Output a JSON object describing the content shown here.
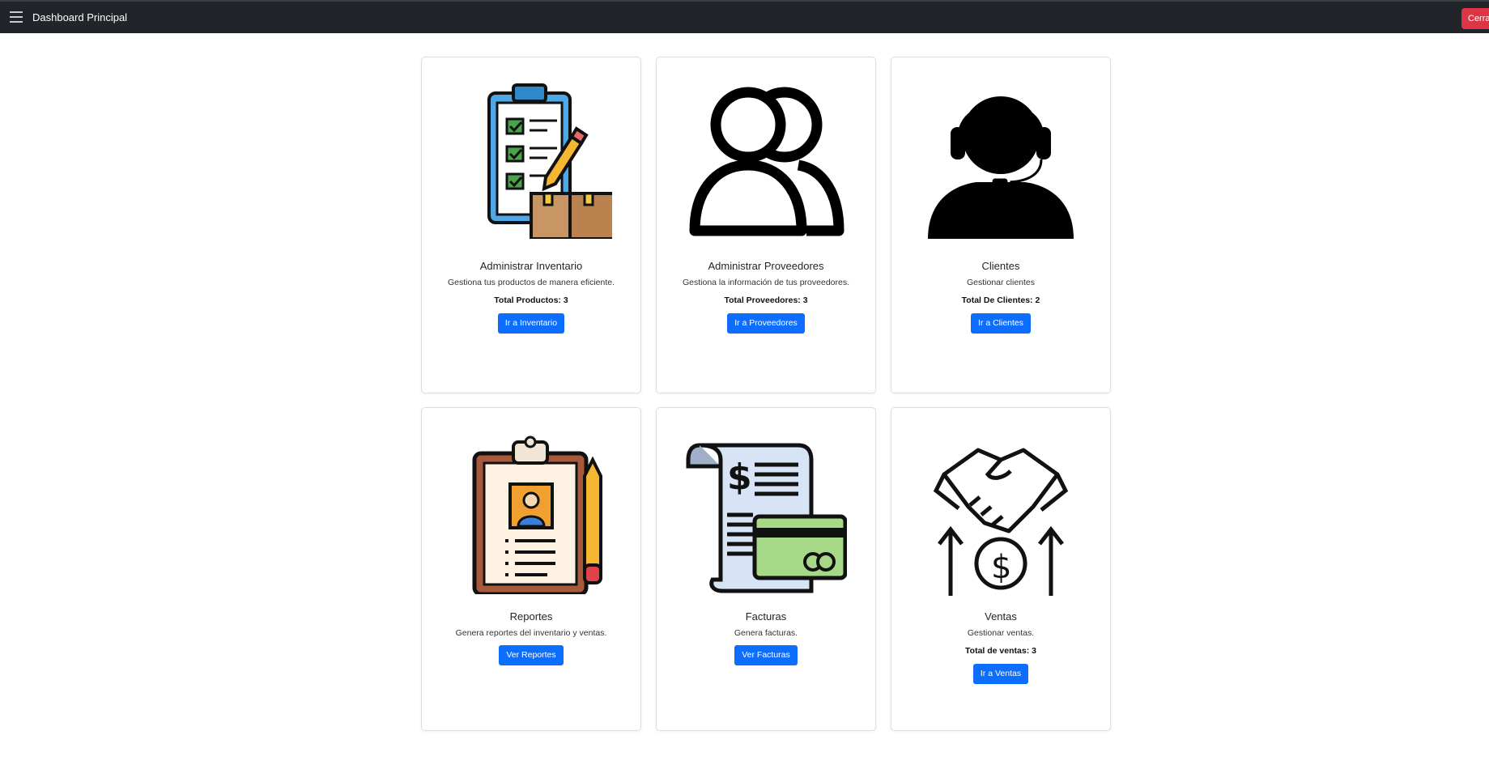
{
  "navbar": {
    "brand": "Dashboard Principal",
    "logout_label": "Cerrar"
  },
  "cards": [
    {
      "title": "Administrar Inventario",
      "text": "Gestiona tus productos de manera eficiente.",
      "count": "Total Productos: 3",
      "button": "Ir a Inventario",
      "icon": "inventory-clipboard-icon"
    },
    {
      "title": "Administrar Proveedores",
      "text": "Gestiona la información de tus proveedores.",
      "count": "Total Proveedores: 3",
      "button": "Ir a Proveedores",
      "icon": "users-icon"
    },
    {
      "title": "Clientes",
      "text": "Gestionar clientes",
      "count": "Total De Clientes: 2",
      "button": "Ir a Clientes",
      "icon": "headset-agent-icon"
    },
    {
      "title": "Reportes",
      "text": "Genera reportes del inventario y ventas.",
      "count": "",
      "button": "Ver Reportes",
      "icon": "report-clipboard-icon"
    },
    {
      "title": "Facturas",
      "text": "Genera facturas.",
      "count": "",
      "button": "Ver Facturas",
      "icon": "invoice-icon"
    },
    {
      "title": "Ventas",
      "text": "Gestionar ventas.",
      "count": "Total de ventas: 3",
      "button": "Ir a Ventas",
      "icon": "handshake-sales-icon"
    }
  ],
  "colors": {
    "navbar": "#212529",
    "primary_button": "#0d6efd",
    "danger_button": "#dc3545"
  }
}
